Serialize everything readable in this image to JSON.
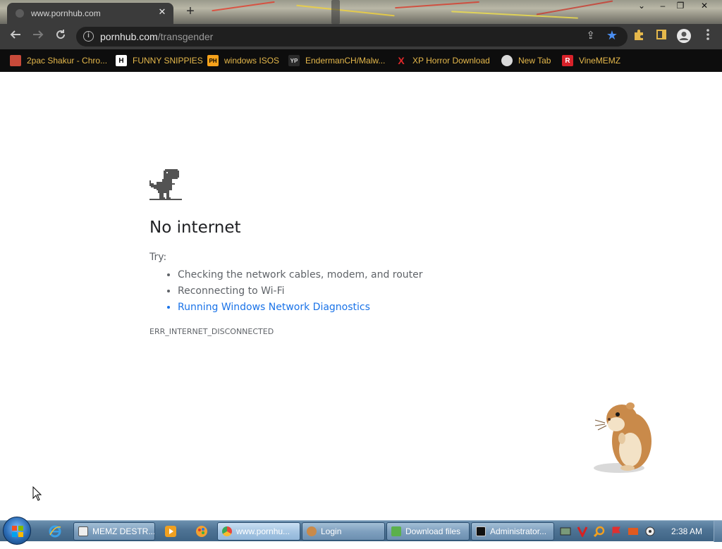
{
  "browser": {
    "tab_title": "www.pornhub.com",
    "tab_close": "✕",
    "new_tab": "+",
    "window_controls": {
      "minimize": "‒",
      "restore": "❐",
      "close": "✕"
    },
    "url_host": "pornhub.com",
    "url_path": "/transgender",
    "accent_color": "#4b8ef0"
  },
  "bookmarks": [
    {
      "label": "2pac Shakur - Chro...",
      "icon": "gift-icon"
    },
    {
      "label": "FUNNY SNIPPIES",
      "icon": "H"
    },
    {
      "label": "windows ISOS",
      "icon": "PH"
    },
    {
      "label": "EndermanCH/Malw...",
      "icon": "YP"
    },
    {
      "label": "XP Horror Download",
      "icon": "X"
    },
    {
      "label": "New Tab",
      "icon": "globe-icon"
    },
    {
      "label": "VineMEMZ",
      "icon": "R"
    }
  ],
  "error_page": {
    "heading": "No internet",
    "try_label": "Try:",
    "suggestions": [
      "Checking the network cables, modem, and router",
      "Reconnecting to Wi-Fi",
      "Running Windows Network Diagnostics"
    ],
    "error_code": "ERR_INTERNET_DISCONNECTED",
    "link_color": "#1a73e8"
  },
  "taskbar": {
    "tasks": [
      {
        "label": "MEMZ DESTR...",
        "icon": "memz-icon"
      },
      {
        "label": "www.pornhu...",
        "icon": "chrome-icon"
      },
      {
        "label": "Login",
        "icon": "user-icon"
      },
      {
        "label": "Download files",
        "icon": "download-icon"
      },
      {
        "label": "Administrator...",
        "icon": "cmd-icon"
      }
    ],
    "clock": "2:38 AM"
  }
}
